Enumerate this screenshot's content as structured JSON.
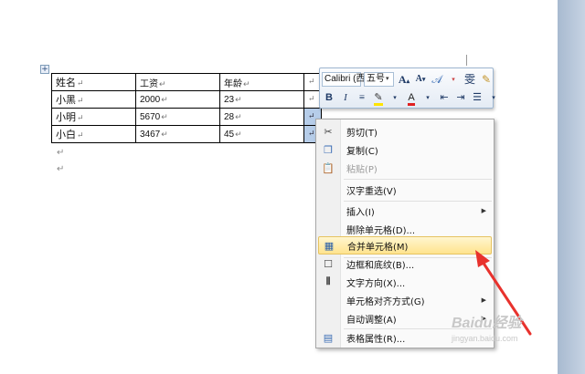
{
  "table": {
    "rows": [
      [
        "姓名",
        "工资",
        "年龄",
        ""
      ],
      [
        "小黑",
        "2000",
        "23",
        ""
      ],
      [
        "小明",
        "5670",
        "28",
        ""
      ],
      [
        "小白",
        "3467",
        "45",
        ""
      ]
    ]
  },
  "paragraph_mark": "↵",
  "mini_toolbar": {
    "font_name": "Calibri (西",
    "font_size": "五号",
    "grow_font_label": "A",
    "shrink_font_label": "A",
    "bold_label": "B",
    "italic_label": "I",
    "font_color_label": "A"
  },
  "context_menu": {
    "items": [
      {
        "label": "剪切(T)",
        "icon": "scissors-icon"
      },
      {
        "label": "复制(C)",
        "icon": "copy-icon"
      },
      {
        "label": "粘贴(P)",
        "icon": "paste-icon",
        "disabled": true
      },
      {
        "label": "汉字重选(V)"
      },
      {
        "label": "插入(I)",
        "submenu": true
      },
      {
        "label": "删除单元格(D)..."
      },
      {
        "label": "合并单元格(M)",
        "icon": "merge-cells-icon",
        "highlighted": true
      },
      {
        "label": "边框和底纹(B)...",
        "icon": "borders-icon"
      },
      {
        "label": "文字方向(X)...",
        "icon": "text-direction-icon"
      },
      {
        "label": "单元格对齐方式(G)",
        "submenu": true
      },
      {
        "label": "自动调整(A)",
        "submenu": true
      },
      {
        "label": "表格属性(R)...",
        "icon": "table-properties-icon"
      }
    ]
  },
  "watermark": {
    "brand": "Baidu经验",
    "url": "jingyan.baidu.com"
  },
  "colors": {
    "highlight": "#ffe48e",
    "arrow": "#e8322d",
    "selection": "#b6cde9"
  }
}
